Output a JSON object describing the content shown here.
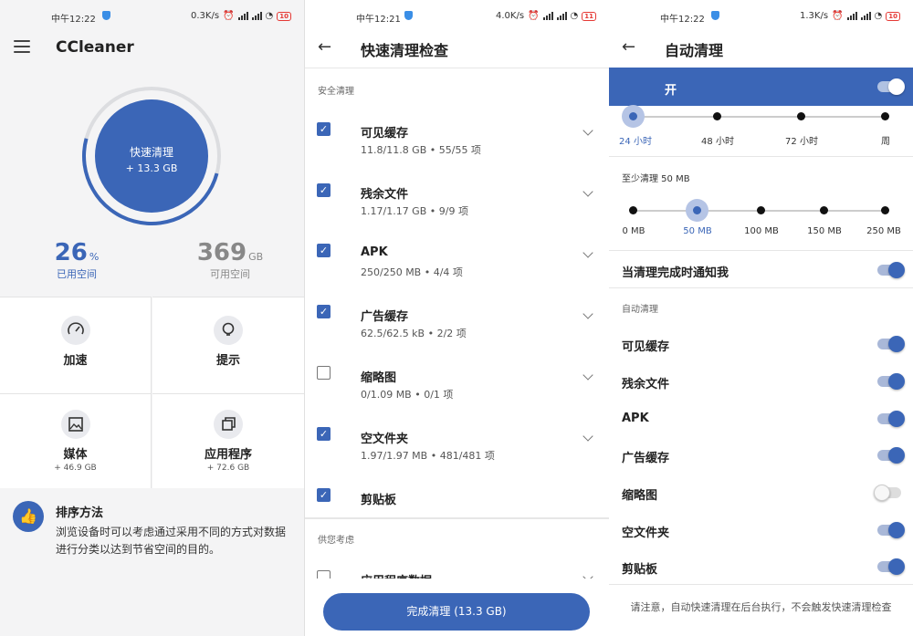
{
  "screen1": {
    "status": {
      "time": "中午12:22",
      "speed": "0.3K/s",
      "battery": "10"
    },
    "title": "CCleaner",
    "quick_clean": {
      "label": "快速清理",
      "size": "+ 13.3 GB"
    },
    "used": {
      "value": "26",
      "unit": "%",
      "label": "已用空间"
    },
    "free": {
      "value": "369",
      "unit": "GB",
      "label": "可用空间"
    },
    "tiles": [
      {
        "label": "加速",
        "sub": "",
        "icon": "speedometer-icon"
      },
      {
        "label": "提示",
        "sub": "",
        "icon": "lightbulb-icon"
      },
      {
        "label": "媒体",
        "sub": "+ 46.9 GB",
        "icon": "image-icon"
      },
      {
        "label": "应用程序",
        "sub": "+ 72.6 GB",
        "icon": "apps-icon"
      }
    ],
    "tip": {
      "title": "排序方法",
      "text": "浏览设备时可以考虑通过采用不同的方式对数据进行分类以达到节省空间的目的。"
    }
  },
  "screen2": {
    "status": {
      "time": "中午12:21",
      "speed": "4.0K/s",
      "battery": "11"
    },
    "title": "快速清理检查",
    "section_safe": "安全清理",
    "items": [
      {
        "title": "可见缓存",
        "sub": "11.8/11.8 GB • 55/55 项",
        "checked": true
      },
      {
        "title": "残余文件",
        "sub": "1.17/1.17 GB • 9/9 项",
        "checked": true
      },
      {
        "title": "APK",
        "sub": "250/250 MB • 4/4 项",
        "checked": true
      },
      {
        "title": "广告缓存",
        "sub": "62.5/62.5 kB • 2/2 项",
        "checked": true
      },
      {
        "title": "缩略图",
        "sub": "0/1.09 MB • 0/1 项",
        "checked": false
      },
      {
        "title": "空文件夹",
        "sub": "1.97/1.97 MB • 481/481 项",
        "checked": true
      },
      {
        "title": "剪贴板",
        "sub": "",
        "checked": true
      }
    ],
    "section_consider": "供您考虑",
    "partial_item": "应用程序数据",
    "finish_button": "完成清理 (13.3 GB)"
  },
  "screen3": {
    "status": {
      "time": "中午12:22",
      "speed": "1.3K/s",
      "battery": "10"
    },
    "title": "自动清理",
    "master_toggle": {
      "label": "开",
      "on": true
    },
    "interval_ticks": [
      "24 小时",
      "48 小时",
      "72 小时",
      "周"
    ],
    "interval_selected": 0,
    "min_clean_label": "至少清理 50 MB",
    "size_ticks": [
      "0 MB",
      "50 MB",
      "100 MB",
      "150 MB",
      "250 MB"
    ],
    "size_selected": 1,
    "notify": {
      "label": "当清理完成时通知我",
      "on": true
    },
    "section_auto": "自动清理",
    "toggles": [
      {
        "label": "可见缓存",
        "on": true
      },
      {
        "label": "残余文件",
        "on": true
      },
      {
        "label": "APK",
        "on": true
      },
      {
        "label": "广告缓存",
        "on": true
      },
      {
        "label": "缩略图",
        "on": false
      },
      {
        "label": "空文件夹",
        "on": true
      },
      {
        "label": "剪贴板",
        "on": true
      }
    ],
    "note": "请注意，自动快速清理在后台执行，不会触发快速清理检查"
  },
  "colors": {
    "accent": "#3b66b7",
    "accent_light": "#b5c4e5",
    "battery": "#e53935"
  }
}
